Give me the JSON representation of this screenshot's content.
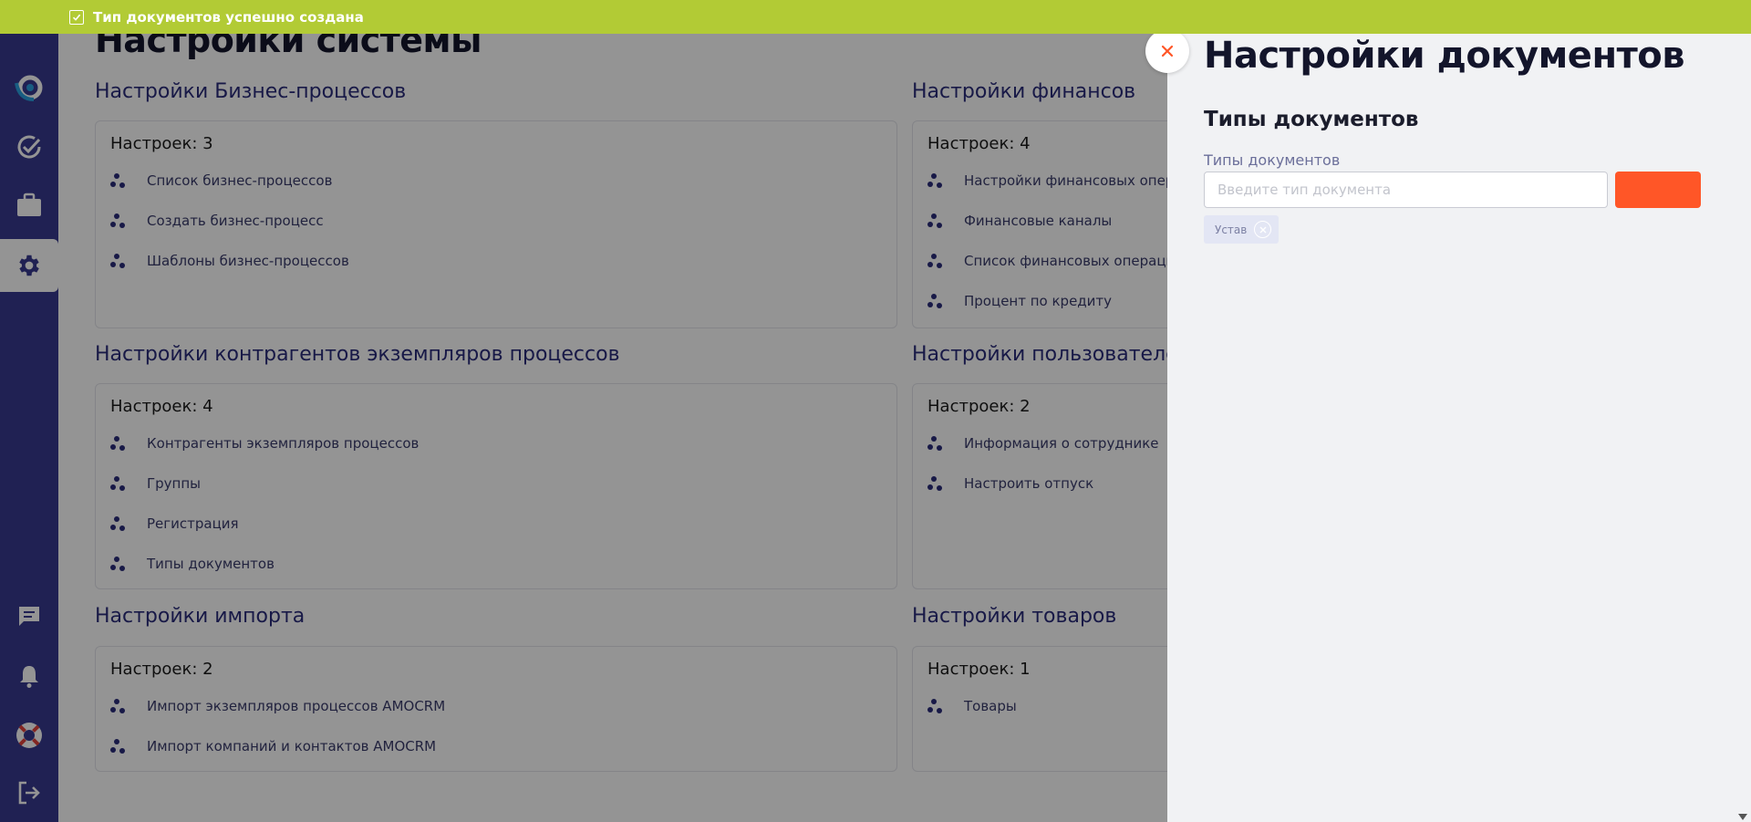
{
  "toast": {
    "message": "Тип документов успешно создана",
    "color": "#b2cb35"
  },
  "sidebar": {
    "background": "#383a8f",
    "top_icons": [
      {
        "name": "logo-icon",
        "active": false
      },
      {
        "name": "tasks-check-icon",
        "active": false
      },
      {
        "name": "briefcase-icon",
        "active": false
      },
      {
        "name": "gear-icon",
        "active": true
      }
    ],
    "bottom_icons": [
      {
        "name": "chat-icon"
      },
      {
        "name": "bell-icon"
      },
      {
        "name": "lifebuoy-icon"
      },
      {
        "name": "logout-icon"
      }
    ]
  },
  "page": {
    "title": "Настройки системы"
  },
  "sections": [
    {
      "title": "Настройки Бизнес-процессов",
      "count": "Настроек: 3",
      "items": [
        "Список бизнес-процессов",
        "Создать бизнес-процесс",
        "Шаблоны бизнес-процессов"
      ]
    },
    {
      "title": "Настройки финансов",
      "count": "Настроек: 4",
      "items": [
        "Настройки финансовых операций",
        "Финансовые каналы",
        "Список финансовых операций",
        "Процент по кредиту"
      ]
    },
    {
      "title": "Настройки контрагентов экземпляров процессов",
      "count": "Настроек: 4",
      "items": [
        "Контрагенты экземпляров процессов",
        "Группы",
        "Регистрация",
        "Типы документов"
      ]
    },
    {
      "title": "Настройки пользователей",
      "count": "Настроек: 2",
      "items": [
        "Информация о сотруднике",
        "Настроить отпуск"
      ]
    },
    {
      "title": "Настройки импорта",
      "count": "Настроек: 2",
      "items": [
        "Импорт экземпляров процессов AMOCRM",
        "Импорт компаний и контактов AMOCRM"
      ]
    },
    {
      "title": "Настройки товаров",
      "count": "Настроек: 1",
      "items": [
        "Товары"
      ]
    }
  ],
  "drawer": {
    "title": "Настройки документов",
    "subtitle": "Типы документов",
    "field_label": "Типы документов",
    "input_placeholder": "Введите тип документа",
    "input_value": "",
    "add_button_label": "",
    "add_button_color": "#ff5627",
    "chips": [
      "Устав"
    ],
    "close_icon": "close-icon"
  }
}
